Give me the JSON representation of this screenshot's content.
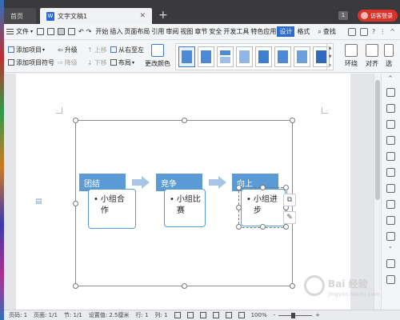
{
  "titlebar": {
    "home_tab": "首页",
    "doc_tab": "文字文稿1",
    "doc_icon": "W",
    "close_glyph": "✕",
    "add_glyph": "+",
    "window_count": "1",
    "login_label": "访客登录"
  },
  "menubar": {
    "file_label": "文件",
    "tabs": [
      "开始",
      "插入",
      "页面布局",
      "引用",
      "审阅",
      "视图",
      "章节",
      "安全",
      "开发工具",
      "特色应用",
      "设计",
      "格式"
    ],
    "active_tab": "设计",
    "search_label": "查找",
    "right_glyphs": [
      "?",
      "⋮",
      "^"
    ]
  },
  "ribbon": {
    "add_item": "添加项目",
    "add_bullet": "添加项目符号",
    "upgrade": "升级",
    "downgrade": "降级",
    "move_up": "上移",
    "move_down": "下移",
    "rtl": "从右至左",
    "layout": "布局",
    "change_color": "更改颜色",
    "wrap": "环绕",
    "align": "对齐",
    "select_pane": "选"
  },
  "smartart": {
    "nodes": [
      {
        "title": "团结",
        "body": "小组合作"
      },
      {
        "title": "竞争",
        "body": "小组比赛"
      },
      {
        "title": "向上",
        "body": "小组进步"
      }
    ]
  },
  "statusbar": {
    "page": "页码: 1",
    "pages": "页面: 1/1",
    "section": "节: 1/1",
    "setting": "设置值: 2.5厘米",
    "row": "行: 1",
    "col": "列: 1",
    "zoom": "100%",
    "zoom_minus": "-",
    "zoom_plus": "+"
  },
  "watermark": {
    "line1": "Bai 经验",
    "line2": "jingyan.baidu.com"
  },
  "colors": {
    "accent": "#2c6bd0",
    "node_blue": "#5b9bd5",
    "arrow": "#a9c4e6",
    "login_red": "#d9342b"
  }
}
